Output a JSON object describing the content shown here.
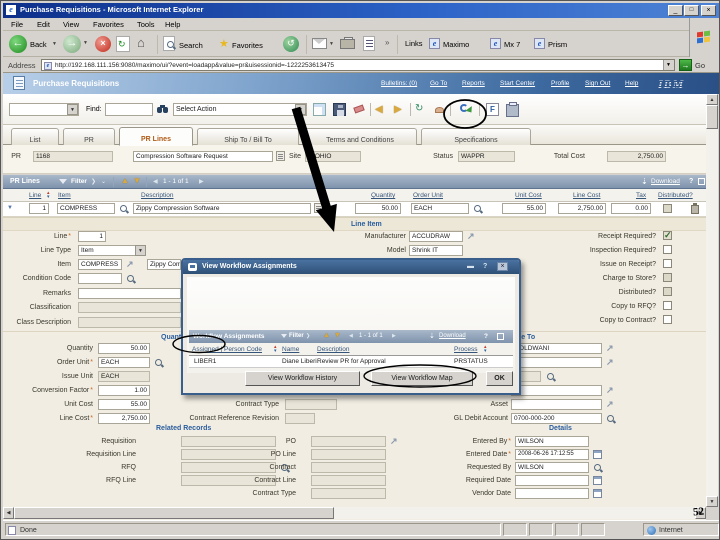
{
  "window": {
    "title": "Purchase Requisitions - Microsoft Internet Explorer",
    "menu": [
      "File",
      "Edit",
      "View",
      "Favorites",
      "Tools",
      "Help"
    ],
    "toolbar": {
      "back": "Back",
      "search": "Search",
      "favorites": "Favorites"
    },
    "links_bar": {
      "label": "Links",
      "items": [
        "Maximo",
        "Mx 7",
        "Prism"
      ]
    },
    "address": {
      "label": "Address",
      "url": "http://192.168.111.156:9080/maximo/ui/?event=loadapp&value=pr&uisessionid=-1222253613475",
      "go": "Go"
    }
  },
  "app_header": {
    "title": "Purchase Requisitions",
    "links": [
      "Bulletins: (0)",
      "Go To",
      "Reports",
      "Start Center",
      "Profile",
      "Sign Out",
      "Help"
    ],
    "logo": "IBM"
  },
  "action_bar": {
    "find_label": "Find:",
    "select_action": "Select Action"
  },
  "tabs": {
    "items": [
      "List",
      "PR",
      "PR Lines",
      "Ship To / Bill To",
      "Terms and Conditions",
      "Specifications"
    ],
    "active": "PR Lines"
  },
  "ident": {
    "pr_label": "PR",
    "pr": "1168",
    "description": "Compression Software Request",
    "site_label": "Site",
    "site": "R-OHIO",
    "status_label": "Status",
    "status": "WAPPR",
    "total_cost_label": "Total Cost",
    "total_cost": "2,750.00"
  },
  "pr_lines": {
    "title": "PR Lines",
    "filter": "Filter",
    "pager": "1 - 1 of 1",
    "download": "Download",
    "columns": [
      "Line",
      "Item",
      "Description",
      "Quantity",
      "Order Unit",
      "Unit Cost",
      "Line Cost",
      "Tax",
      "Distributed?"
    ],
    "row": {
      "line": "1",
      "item": "COMPRESS",
      "description": "Zippy Compression Software",
      "quantity": "50.00",
      "order_unit": "EACH",
      "unit_cost": "55.00",
      "line_cost": "2,750.00",
      "tax": "0.00"
    }
  },
  "line_item": {
    "header": "Line Item",
    "line_label": "Line",
    "line": "1",
    "line_type_label": "Line Type",
    "line_type": "Item",
    "item_label": "Item",
    "item": "COMPRESS",
    "item_desc": "Zippy Compression Software",
    "condition_label": "Condition Code",
    "remarks_label": "Remarks",
    "classification_label": "Classification",
    "class_desc_label": "Class Description",
    "manufacturer_label": "Manufacturer",
    "manufacturer": "ACCUDRAW",
    "model_label": "Model",
    "model": "Shrink IT",
    "checkboxes": [
      {
        "label": "Receipt Required?",
        "state": "checked"
      },
      {
        "label": "Inspection Required?",
        "state": "empty"
      },
      {
        "label": "Issue on Receipt?",
        "state": "empty"
      },
      {
        "label": "Charge to Store?",
        "state": "disabled"
      },
      {
        "label": "Distributed?",
        "state": "disabled"
      },
      {
        "label": "Copy to RFQ?",
        "state": "empty"
      },
      {
        "label": "Copy to Contract?",
        "state": "empty"
      }
    ]
  },
  "quantity": {
    "header": "Quantity",
    "rows": [
      {
        "label": "Quantity",
        "value": "50.00"
      },
      {
        "label": "Order Unit",
        "value": "EACH"
      },
      {
        "label": "Issue Unit",
        "value": "EACH"
      },
      {
        "label": "Conversion Factor",
        "value": "1.00"
      },
      {
        "label": "Unit Cost",
        "value": "55.00"
      },
      {
        "label": "Line Cost",
        "value": "2,750.00"
      }
    ],
    "contract_type_label": "Contract Type",
    "contract_ref_label": "Contract Reference  Revision"
  },
  "charge_to": {
    "header": "Charge To",
    "requested_for": "GOLDWANI",
    "asset_label": "Asset",
    "gl_label": "GL Debit Account",
    "gl": "0700-000-200"
  },
  "related_records": {
    "header": "Related Records",
    "left_labels": [
      "Requisition",
      "Requisition Line",
      "RFQ",
      "RFQ Line"
    ],
    "mid_labels": [
      "PO",
      "PO Line",
      "Contract",
      "Contract Line",
      "Contract Type"
    ]
  },
  "details": {
    "header": "Details",
    "rows": [
      {
        "label": "Entered By",
        "value": "WILSON",
        "req": true
      },
      {
        "label": "Entered Date",
        "value": "2008-06-26 17:12:55",
        "req": true
      },
      {
        "label": "Requested By",
        "value": "WILSON",
        "req": false
      },
      {
        "label": "Required Date",
        "value": "",
        "req": false
      },
      {
        "label": "Vendor Date",
        "value": "",
        "req": false
      }
    ]
  },
  "dialog": {
    "title": "View Workflow Assignments",
    "table_title": "Workflow Assignments",
    "filter": "Filter",
    "pager": "1 - 1 of 1",
    "download": "Download",
    "columns": [
      "Assigned | Person Code",
      "Name",
      "Description",
      "Process"
    ],
    "row": {
      "person": "LIBER1",
      "name": "Diane Liberi",
      "description": "Review PR for Approval",
      "process": "PRSTATUS"
    },
    "buttons": [
      "View Workflow History",
      "View Workflow Map",
      "OK"
    ]
  },
  "status_bar": {
    "left": "Done",
    "zone": "Internet"
  },
  "annotations": {
    "page_number": "52"
  },
  "icons": {
    "circled_toolbar_icon": "route-workflow-icon",
    "arrow": "points from Select Action menu to Line Item form"
  }
}
